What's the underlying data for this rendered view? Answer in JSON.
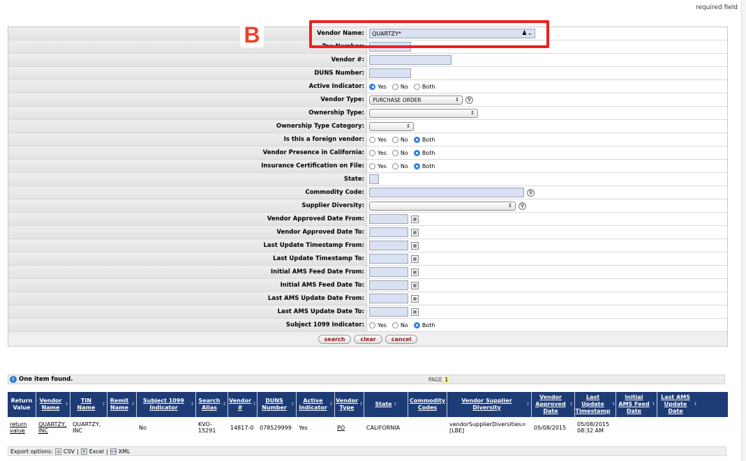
{
  "header": {
    "required_text": "required field"
  },
  "annotation": {
    "badge_letter": "B"
  },
  "search_form": {
    "vendor_name": {
      "label": "Vendor Name:",
      "value": "QUARTZY*"
    },
    "tax_number": {
      "label": "Tax Number:"
    },
    "vendor_num": {
      "label": "Vendor #:"
    },
    "duns": {
      "label": "DUNS Number:"
    },
    "active": {
      "label": "Active Indicator:",
      "options": [
        "Yes",
        "No",
        "Both"
      ]
    },
    "vendor_type": {
      "label": "Vendor Type:",
      "value": "PURCHASE ORDER"
    },
    "ownership_type": {
      "label": "Ownership Type:"
    },
    "ownership_cat": {
      "label": "Ownership Type Category:"
    },
    "foreign": {
      "label": "Is this a foreign vendor:",
      "options": [
        "Yes",
        "No",
        "Both"
      ]
    },
    "presence_ca": {
      "label": "Vendor Presence in California:",
      "options": [
        "Yes",
        "No",
        "Both"
      ]
    },
    "insurance": {
      "label": "Insurance Certification on File:",
      "options": [
        "Yes",
        "No",
        "Both"
      ]
    },
    "state": {
      "label": "State:"
    },
    "commodity": {
      "label": "Commodity Code:"
    },
    "diversity": {
      "label": "Supplier Diversity:"
    },
    "approved_from": {
      "label": "Vendor Approved Date From:"
    },
    "approved_to": {
      "label": "Vendor Approved Date To:"
    },
    "lu_from": {
      "label": "Last Update Timestamp From:"
    },
    "lu_to": {
      "label": "Last Update Timestamp To:"
    },
    "iams_from": {
      "label": "Initial AMS Feed Date From:"
    },
    "iams_to": {
      "label": "Initial AMS Feed Date To:"
    },
    "lams_from": {
      "label": "Last AMS Update Date From:"
    },
    "lams_to": {
      "label": "Last AMS Update Date To:"
    },
    "s1099": {
      "label": "Subject 1099 Indicator:",
      "options": [
        "Yes",
        "No",
        "Both"
      ]
    },
    "buttons": {
      "search": "search",
      "clear": "clear",
      "cancel": "cancel"
    }
  },
  "results": {
    "found_text": "One item found.",
    "page_label": "PAGE",
    "page_num": "1",
    "columns": [
      "Return Value",
      "Vendor Name",
      "TIN Name",
      "Remit Name",
      "Subject 1099 Indicator",
      "Search Alias",
      "Vendor #",
      "DUNS Number",
      "Active Indicator",
      "Vendor Type",
      "State",
      "Commodity Codes",
      "Vendor Supplier Diversity",
      "Vendor Approved Date",
      "Last Update Timestamp",
      "Initial AMS Feed Date",
      "Last AMS Update Date"
    ],
    "row": {
      "return_value": "return value",
      "vendor_name": "QUARTZY, INC",
      "tin_name": "QUARTZY, INC",
      "remit_name": "",
      "subject1099": "No",
      "search_alias": "KVO-15291",
      "vendor_num": "14817-0",
      "duns": "078529999",
      "active": "Yes",
      "vendor_type": "PO",
      "state": "CALIFORNIA",
      "commodity": "",
      "diversity": "vendorSupplierDiversities=[LBE]",
      "approved_date": "05/08/2015",
      "last_update": "05/08/2015 08:32 AM",
      "initial_ams": "",
      "last_ams": ""
    }
  },
  "export": {
    "label": "Export options:",
    "csv": "CSV",
    "excel": "Excel",
    "xml": "XML"
  }
}
